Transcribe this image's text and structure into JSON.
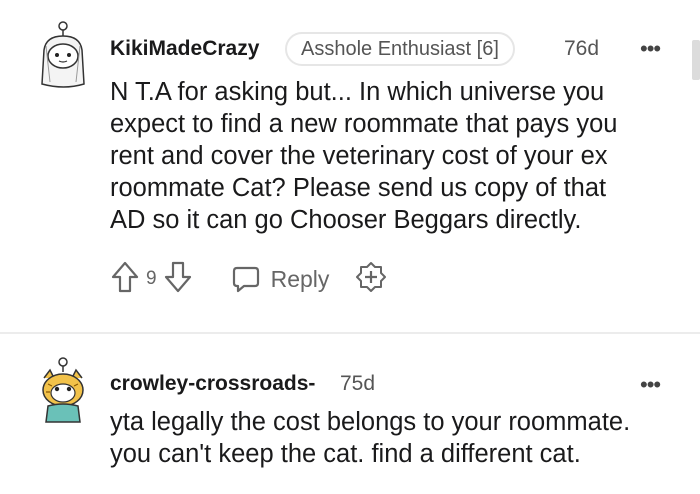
{
  "comments": [
    {
      "username": "KikiMadeCrazy",
      "flair": "Asshole Enthusiast [6]",
      "age": "76d",
      "more_label": "•••",
      "text": "N T.A for asking but... In which universe you\nexpect to find a new roommate that pays you\nrent and cover the veterinary cost of your ex\nroommate Cat? Please send us copy of that\nAD so it can go Chooser Beggars directly.",
      "vote_count": "9",
      "reply_label": "Reply"
    },
    {
      "username": "crowley-crossroads-",
      "age": "75d",
      "more_label": "•••",
      "text": "yta legally the cost belongs to your roommate.\nyou can't keep the cat. find a different cat."
    }
  ],
  "colors": {
    "text": "#1a1a1b",
    "muted": "#666666",
    "divider": "#ececec",
    "flair_border": "#e6e6e6",
    "avatar2_fill": "#f2c24a"
  },
  "icons": [
    "snoo-avatar-icon",
    "upvote-icon",
    "downvote-icon",
    "reply-bubble-icon",
    "award-plus-icon",
    "more-options-icon"
  ]
}
